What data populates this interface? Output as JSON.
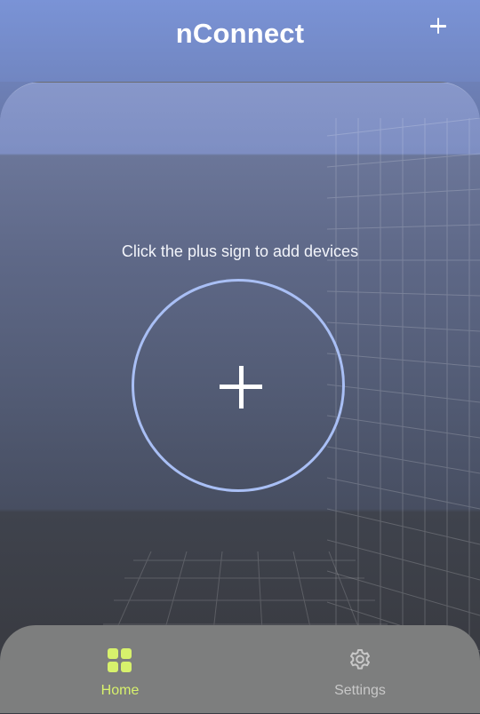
{
  "app": {
    "title": "nConnect"
  },
  "header": {
    "add_icon": "plus-icon"
  },
  "main": {
    "hint": "Click the plus sign to add devices",
    "add_device_icon": "plus-icon"
  },
  "bottom_nav": {
    "items": [
      {
        "label": "Home",
        "icon": "grid-icon",
        "active": true,
        "color": "#d7f16c"
      },
      {
        "label": "Settings",
        "icon": "gear-icon",
        "active": false,
        "color": "#c8c8c8"
      }
    ]
  },
  "colors": {
    "header": "#7a93d6",
    "accent_ring": "#a9bff5",
    "nav_background": "#7d7e7e",
    "active": "#d7f16c"
  }
}
